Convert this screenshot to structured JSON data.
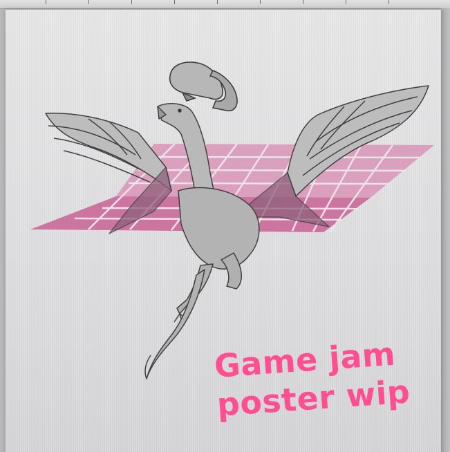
{
  "caption": {
    "line1": "Game jam",
    "line2": "poster wip"
  },
  "colors": {
    "caption": "#ff4f93",
    "grid": "#c2477f",
    "line_art": "#4a4a4a",
    "fill": "#bdbdbd"
  },
  "icons": [
    "vr-headset-icon",
    "dragon-illustration"
  ]
}
